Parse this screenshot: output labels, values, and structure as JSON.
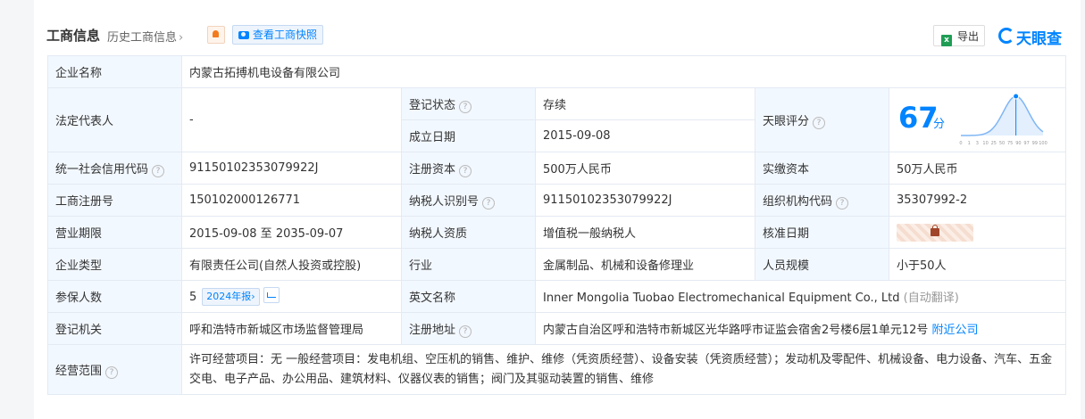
{
  "header": {
    "title": "工商信息",
    "history_link": "历史工商信息",
    "history_chevron": "›",
    "snapshot_button": "查看工商快照",
    "export_button": "导出",
    "brand_name": "天眼查",
    "accent_color": "#0084ff"
  },
  "rows": {
    "company_name": {
      "label": "企业名称",
      "value": "内蒙古拓搏机电设备有限公司"
    },
    "legal_rep": {
      "label": "法定代表人",
      "value": "-"
    },
    "reg_status": {
      "label": "登记状态",
      "value": "存续",
      "value_color": "#2ba24c"
    },
    "founded": {
      "label": "成立日期",
      "value": "2015-09-08"
    },
    "tianyan_score": {
      "label": "天眼评分",
      "score": "67",
      "unit": "分",
      "score_value": 67,
      "scale_ticks": [
        "0",
        "1",
        "3",
        "10",
        "25",
        "50",
        "75",
        "90",
        "97",
        "99",
        "100"
      ]
    },
    "credit_code": {
      "label": "统一社会信用代码",
      "value": "91150102353079922J"
    },
    "reg_capital": {
      "label": "注册资本",
      "value": "500万人民币"
    },
    "paid_capital": {
      "label": "实缴资本",
      "value": "50万人民币"
    },
    "reg_number": {
      "label": "工商注册号",
      "value": "150102000126771"
    },
    "taxpayer_id": {
      "label": "纳税人识别号",
      "value": "91150102353079922J"
    },
    "org_code": {
      "label": "组织机构代码",
      "value": "35307992-2"
    },
    "term": {
      "label": "营业期限",
      "value": "2015-09-08 至 2035-09-07"
    },
    "taxpayer_qual": {
      "label": "纳税人资质",
      "value": "增值税一般纳税人"
    },
    "approval_date": {
      "label": "核准日期"
    },
    "company_type": {
      "label": "企业类型",
      "value": "有限责任公司(自然人投资或控股)"
    },
    "industry": {
      "label": "行业",
      "value": "金属制品、机械和设备修理业"
    },
    "staff_size": {
      "label": "人员规模",
      "value": "小于50人"
    },
    "insured": {
      "label": "参保人数",
      "value": "5",
      "report_tag": "2024年报",
      "report_arrow": "›"
    },
    "english_name": {
      "label": "英文名称",
      "value": "Inner Mongolia Tuobao Electromechanical Equipment Co., Ltd",
      "note": "(自动翻译)"
    },
    "reg_authority": {
      "label": "登记机关",
      "value": "呼和浩特市新城区市场监督管理局"
    },
    "reg_address": {
      "label": "注册地址",
      "value": "内蒙古自治区呼和浩特市新城区光华路呼市证监会宿舍2号楼6层1单元12号",
      "link": "附近公司"
    },
    "scope": {
      "label": "经营范围",
      "value": "许可经营项目：无 一般经营项目：发电机组、空压机的销售、维护、维修（凭资质经营）、设备安装（凭资质经营）；发动机及零配件、机械设备、电力设备、汽车、五金交电、电子产品、办公用品、建筑材料、仪器仪表的销售；阀门及其驱动装置的销售、维修"
    }
  }
}
